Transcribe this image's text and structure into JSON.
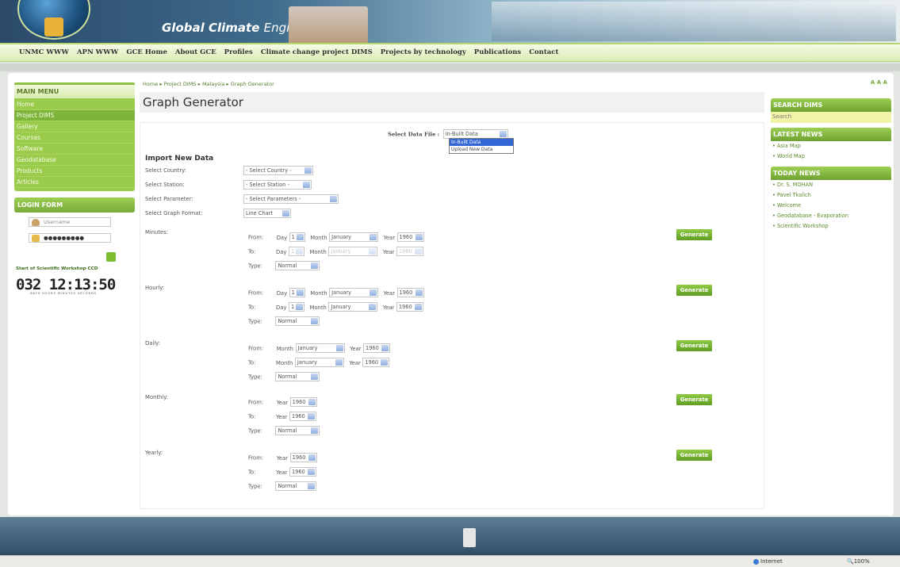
{
  "header": {
    "title_main": "Global Climate",
    "title_sub": "Engine"
  },
  "nav": [
    "UNMC WWW",
    "APN WWW",
    "GCE Home",
    "About GCE",
    "Profiles",
    "Climate change project DIMS",
    "Projects by technology",
    "Publications",
    "Contact"
  ],
  "left": {
    "main_menu_title": "MAIN MENU",
    "menu_items": [
      "Home",
      "Project DIMS",
      "Gallery",
      "Courses",
      "Software",
      "Geodatabase",
      "Products",
      "Articles"
    ],
    "login_title": "LOGIN FORM",
    "username_placeholder": "Username",
    "password_value": "●●●●●●●●●",
    "countdown_label": "Start of Scientific Workshop CCD",
    "countdown": "032 12:13:50",
    "countdown_units": "DAYS  HOURS  MINUTES  SECONDS"
  },
  "breadcrumb": "Home ▸ Project DIMS ▸ Malaysia ▸ Graph Generator",
  "font_size_label": "A A A",
  "page_title": "Graph Generator",
  "select_data_file": {
    "label": "Select Data File :",
    "value": "In-Built Data",
    "options": [
      "In-Built Data",
      "Upload New Data"
    ]
  },
  "import": {
    "title": "Import New Data",
    "country_label": "Select Country:",
    "country_value": "- Select Country -",
    "station_label": "Select Station:",
    "station_value": "- Select Station -",
    "param_label": "Select Parameter:",
    "param_value": "- Select Parameters -",
    "format_label": "Select Graph Format:",
    "format_value": "Line Chart"
  },
  "labels": {
    "from": "From:",
    "to": "To:",
    "type": "Type:",
    "day": "Day",
    "month": "Month",
    "year": "Year",
    "generate": "Generate"
  },
  "sections": [
    {
      "name": "Minutes:",
      "from": {
        "day": "1",
        "month": "January",
        "year": "1960"
      },
      "to": {
        "day": "1",
        "month": "January",
        "year": "1960"
      },
      "type": "Normal"
    },
    {
      "name": "Hourly:",
      "from": {
        "day": "1",
        "month": "January",
        "year": "1960"
      },
      "to": {
        "day": "1",
        "month": "January",
        "year": "1960"
      },
      "type": "Normal"
    },
    {
      "name": "Daily:",
      "from": {
        "month": "January",
        "year": "1960"
      },
      "to": {
        "month": "January",
        "year": "1960"
      },
      "type": "Normal"
    },
    {
      "name": "Monthly:",
      "from": {
        "year": "1960"
      },
      "to": {
        "year": "1960"
      },
      "type": "Normal"
    },
    {
      "name": "Yearly:",
      "from": {
        "year": "1960"
      },
      "to": {
        "year": "1960"
      },
      "type": "Normal"
    }
  ],
  "right": {
    "search_title": "SEARCH DIMS",
    "search_placeholder": "Search",
    "latest_title": "LATEST NEWS",
    "latest_items": [
      "• Asia Map",
      "• World Map"
    ],
    "today_title": "TODAY NEWS",
    "today_items": [
      "• Dr. S. MOHAN",
      "• Pavel Tkalich",
      "• Welcome",
      "• Geodatabase - Evaporation",
      "• Scientific Workshop"
    ]
  },
  "status": {
    "zone": "Internet",
    "zoom": "100%"
  }
}
